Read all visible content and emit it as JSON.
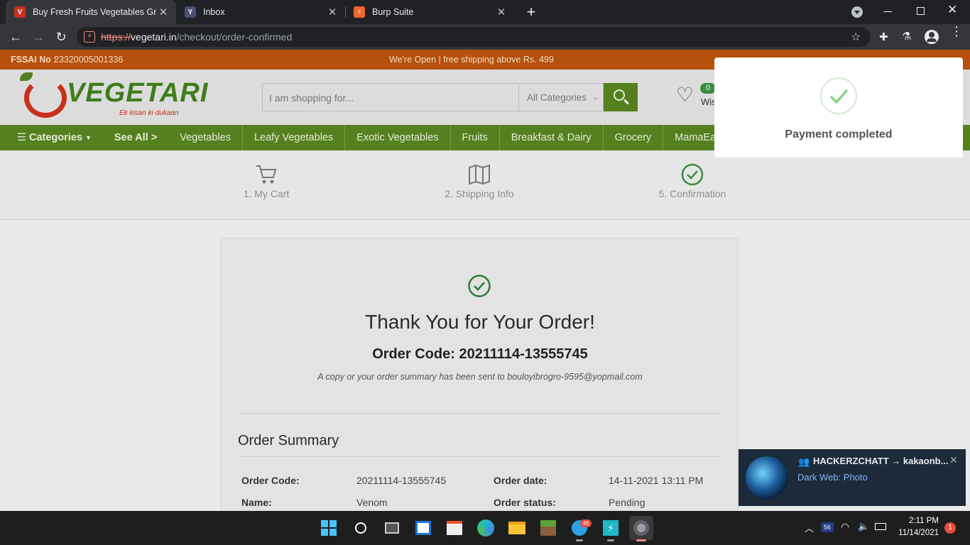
{
  "browser": {
    "tabs": [
      {
        "label": "Buy Fresh Fruits Vegetables Groc",
        "favicon": "vegetari-favicon"
      },
      {
        "label": "Inbox",
        "favicon": "yahoo-favicon"
      },
      {
        "label": "Burp Suite",
        "favicon": "burp-favicon"
      }
    ],
    "new_tab": "+",
    "url_scheme": "https://",
    "url_host": "vegetari.in",
    "url_path": "/checkout/order-confirmed"
  },
  "site": {
    "topbar": {
      "fssai_label": "FSSAI No :",
      "fssai_value": "23320005001336",
      "announcement": "We're Open | free shipping above Rs. 499"
    },
    "logo": {
      "text": "VEGETARI",
      "tagline": "Ek kisan ki dukaan"
    },
    "search": {
      "placeholder": "I am shopping for...",
      "category": "All Categories"
    },
    "wishlist": {
      "count": "0",
      "label": "Wis"
    },
    "nav": [
      "Categories",
      "See All >",
      "Vegetables",
      "Leafy Vegetables",
      "Exotic Vegetables",
      "Fruits",
      "Breakfast & Dairy",
      "Grocery",
      "MamaEarth"
    ],
    "steps": [
      {
        "label": "1. My Cart",
        "icon": "cart-icon"
      },
      {
        "label": "2. Shipping Info",
        "icon": "map-icon"
      },
      {
        "label": "5. Confirmation",
        "icon": "check-circle-icon"
      }
    ],
    "confirmation": {
      "title": "Thank You for Your Order!",
      "order_code_line": "Order Code: 20211114-13555745",
      "copy_note": "A copy or your order summary has been sent to bouloyibrogro-9595@yopmail.com"
    },
    "summary": {
      "heading": "Order Summary",
      "rows": [
        {
          "label1": "Order Code:",
          "value1": "20211114-13555745",
          "label2": "Order date:",
          "value2": "14-11-2021 13:11 PM"
        },
        {
          "label1": "Name:",
          "value1": "Venom",
          "label2": "Order status:",
          "value2": "Pending"
        }
      ]
    }
  },
  "toast": {
    "message": "Payment completed"
  },
  "notification": {
    "title": "HACKERZCHATT → kakaonb...",
    "body": "Dark Web: Photo"
  },
  "taskbar": {
    "telegram_badge": "46",
    "tray_badge": "56",
    "time": "2:11 PM",
    "date": "11/14/2021",
    "notification_count": "1"
  },
  "colors": {
    "brand_green": "#55801f",
    "accent_orange": "#b5510d",
    "success": "#3a8a3f"
  }
}
